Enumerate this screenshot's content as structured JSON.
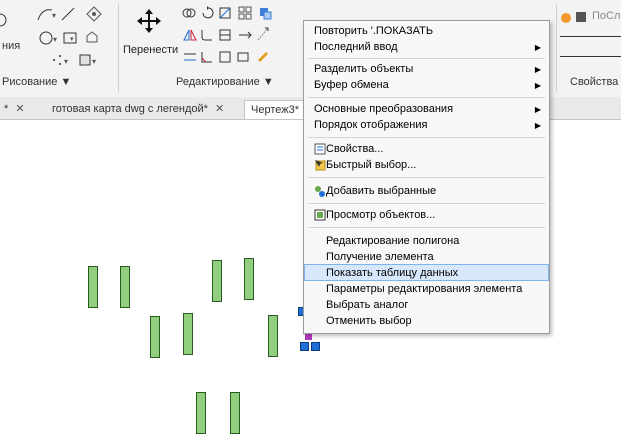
{
  "ribbon": {
    "left_partial_label": "ния",
    "move_label": "Перенести",
    "group_draw": "Рисование ▼",
    "group_edit": "Редактирование ▼",
    "props_label": "Свойства",
    "layer_label": "ПоСло"
  },
  "tabs": [
    {
      "label": "*",
      "close": "✕"
    },
    {
      "label": "готовая карта dwg с легендой*",
      "close": "✕"
    },
    {
      "label": "Чертеж3*",
      "close": ""
    }
  ],
  "menu": {
    "items": [
      {
        "label": "Повторить '.ПОКАЗАТЬ",
        "arrow": ""
      },
      {
        "label": "Последний ввод",
        "arrow": "▶"
      },
      {
        "label": "Разделить объекты",
        "arrow": "▶"
      },
      {
        "label": "Буфер обмена",
        "arrow": "▶"
      },
      {
        "label": "Основные преобразования",
        "arrow": "▶"
      },
      {
        "label": "Порядок отображения",
        "arrow": "▶"
      },
      {
        "label": "Свойства...",
        "arrow": "",
        "icon": "properties-icon"
      },
      {
        "label": "Быстрый выбор...",
        "arrow": "",
        "icon": "quick-select-icon"
      },
      {
        "label": "Добавить выбранные",
        "arrow": "",
        "icon": "add-selected-icon"
      },
      {
        "label": "Просмотр объектов...",
        "arrow": "",
        "icon": "object-viewer-icon"
      },
      {
        "label": "Редактирование полигона",
        "arrow": ""
      },
      {
        "label": "Получение элемента",
        "arrow": ""
      },
      {
        "label": "Показать таблицу данных",
        "arrow": "",
        "highlighted": true
      },
      {
        "label": "Параметры редактирования элемента",
        "arrow": ""
      },
      {
        "label": "Выбрать аналог",
        "arrow": ""
      },
      {
        "label": "Отменить выбор",
        "arrow": ""
      }
    ]
  },
  "colors": {
    "bar_fill": "#8fcf7e",
    "bar_stroke": "#2d5a22",
    "highlight": "#d7e8fc",
    "grip": "#1e6fd6"
  }
}
